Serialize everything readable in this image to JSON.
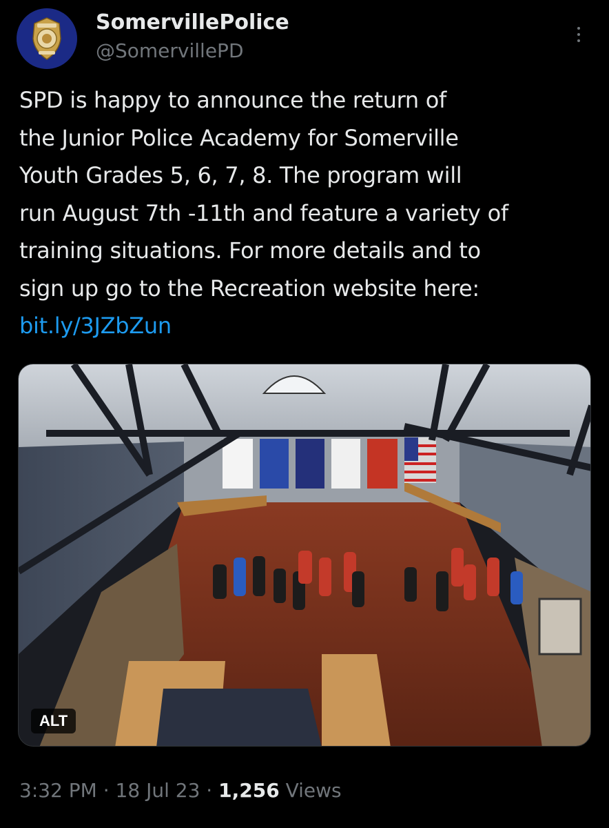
{
  "author": {
    "display_name": "SomervillePolice",
    "handle": "@SomervillePD",
    "avatar_icon": "police-badge-icon"
  },
  "more_icon": "more-vertical-icon",
  "tweet": {
    "lines": [
      "SPD is happy to announce the return of",
      "the Junior Police Academy for Somerville",
      "Youth Grades 5, 6, 7, 8. The program will",
      "run August 7th -11th and feature a variety of",
      "training situations. For more details and to",
      "sign up go to the Recreation website here:"
    ],
    "link": "bit.ly/3JZbZun"
  },
  "media": {
    "alt_label": "ALT"
  },
  "meta": {
    "time": "3:32 PM",
    "separator": "·",
    "date": "18 Jul 23",
    "views_count": "1,256",
    "views_label": "Views"
  },
  "colors": {
    "background": "#000000",
    "text": "#e7e9ea",
    "muted": "#71767b",
    "link": "#1d9bf0"
  }
}
